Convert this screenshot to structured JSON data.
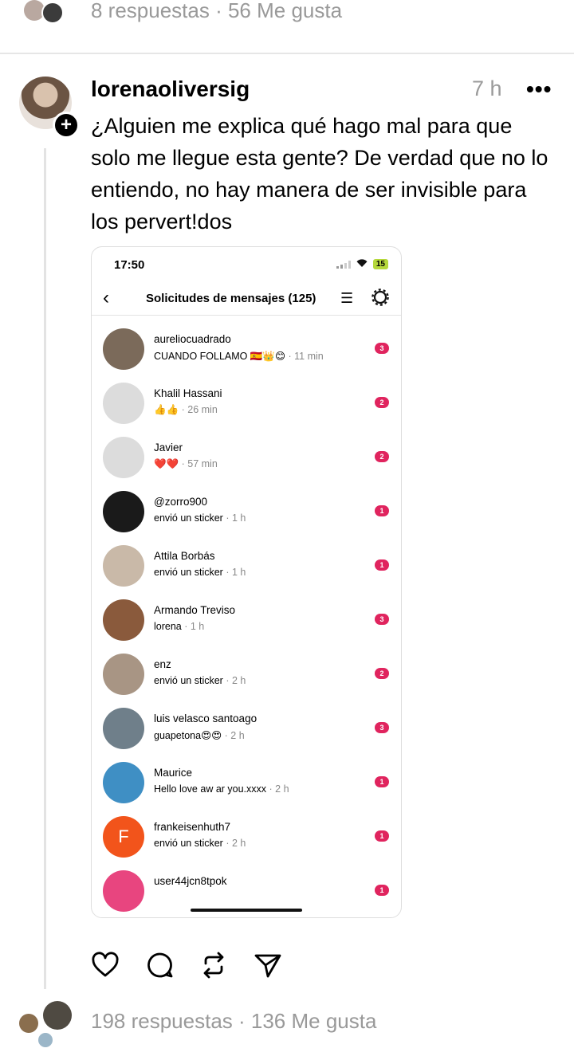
{
  "prev_post": {
    "stats": "8 respuestas · 56 Me gusta"
  },
  "post": {
    "username": "lorenaoliversig",
    "time": "7 h",
    "more": "•••",
    "follow": "+",
    "text": "¿Alguien me explica qué hago mal para que solo me llegue esta gente? De verdad que no lo entiendo, no hay manera de ser invisible para los pervert!dos",
    "stats": "198 respuestas · 136 Me gusta"
  },
  "screenshot": {
    "status_time": "17:50",
    "battery": "15",
    "title": "Solicitudes de mensajes (125)",
    "requests": [
      {
        "name": "aureliocuadrado",
        "message": "CUANDO FOLLAMO 🇪🇸👑😊",
        "time": " · 11 min",
        "badge": "3",
        "avatar_color": "#7b6a5a"
      },
      {
        "name": "Khalil Hassani",
        "message": "👍👍",
        "time": " · 26 min",
        "badge": "2",
        "avatar_color": "#dcdcdc"
      },
      {
        "name": "Javier",
        "message": "❤️❤️",
        "time": " · 57 min",
        "badge": "2",
        "avatar_color": "#dcdcdc"
      },
      {
        "name": "@zorro900",
        "message": "envió un sticker",
        "time": " · 1 h",
        "badge": "1",
        "avatar_color": "#1a1a1a"
      },
      {
        "name": "Attila Borbás",
        "message": "envió un sticker",
        "time": " · 1 h",
        "badge": "1",
        "avatar_color": "#c9b9a8"
      },
      {
        "name": "Armando Treviso",
        "message": "lorena",
        "time": " · 1 h",
        "badge": "3",
        "avatar_color": "#8a5a3c"
      },
      {
        "name": "enz",
        "message": "envió un sticker",
        "time": " · 2 h",
        "badge": "2",
        "avatar_color": "#a89584"
      },
      {
        "name": "luis velasco santoago",
        "message": "guapetona😍😍",
        "time": " · 2 h",
        "badge": "3",
        "avatar_color": "#6f7f8a"
      },
      {
        "name": "Maurice",
        "message": "Hello love aw ar you.xxxx",
        "time": " · 2 h",
        "badge": "1",
        "avatar_color": "#3f8fc4"
      },
      {
        "name": "frankeisenhuth7",
        "message": "envió un sticker",
        "time": " · 2 h",
        "badge": "1",
        "avatar_color": "#f2541b",
        "initial": "F"
      },
      {
        "name": "user44jcn8tpok",
        "message": "",
        "time": "",
        "badge": "1",
        "avatar_color": "#e8457f"
      }
    ]
  },
  "colors": {
    "badge": "#e0245e",
    "muted": "#999999"
  },
  "icons": {
    "actions": [
      "heart-icon",
      "comment-icon",
      "repost-icon",
      "share-icon"
    ]
  }
}
